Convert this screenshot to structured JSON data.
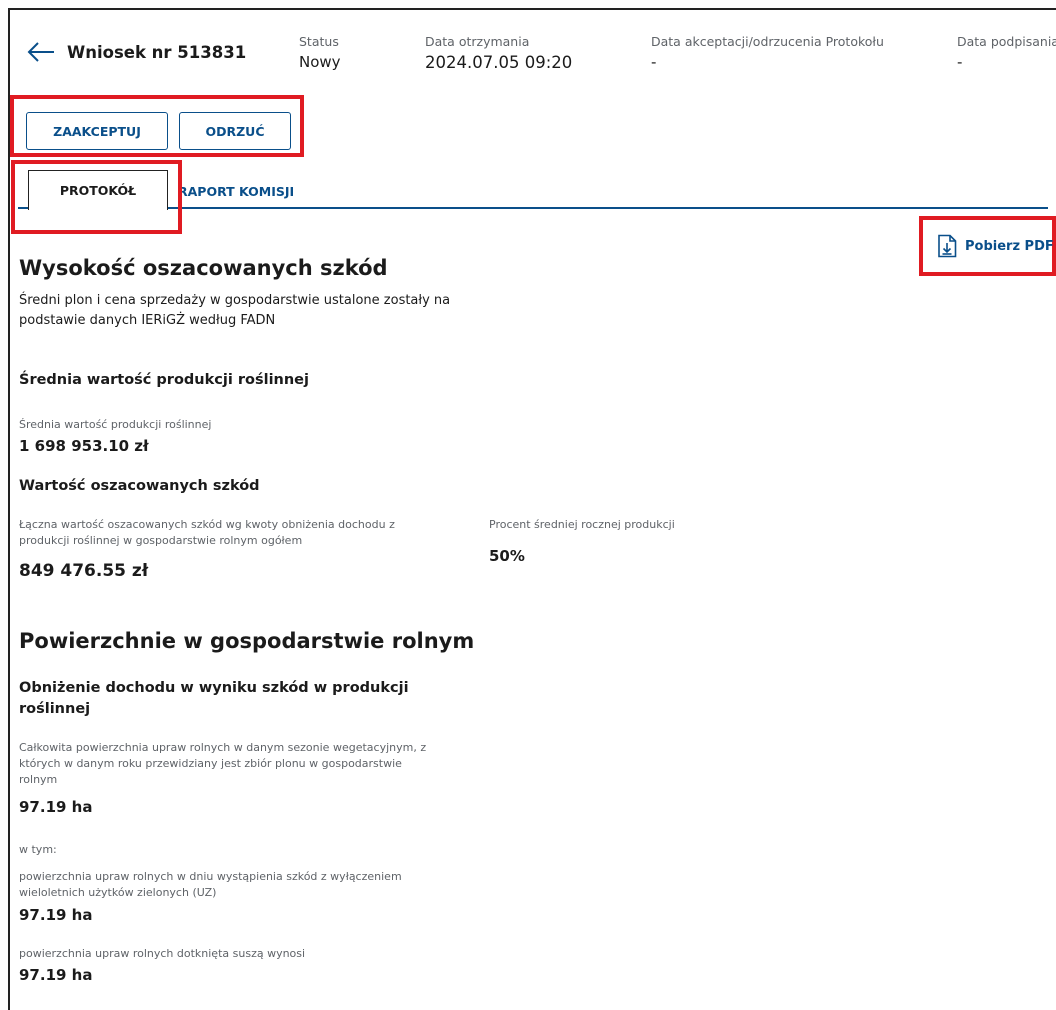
{
  "header": {
    "title": "Wniosek nr 513831",
    "status": {
      "label": "Status",
      "value": "Nowy"
    },
    "received": {
      "label": "Data otrzymania",
      "value": "2024.07.05 09:20"
    },
    "decision_date": {
      "label": "Data akceptacji/odrzucenia Protokołu",
      "value": "-"
    },
    "signed_date": {
      "label": "Data podpisania",
      "value": "-"
    }
  },
  "actions": {
    "accept_label": "ZAAKCEPTUJ",
    "reject_label": "ODRZUĆ"
  },
  "tabs": [
    {
      "label": "PROTOKÓŁ",
      "active": true
    },
    {
      "label": "RAPORT KOMISJI",
      "active": false
    }
  ],
  "download": {
    "label": "Pobierz PDF",
    "icon": "file-download-icon"
  },
  "damage": {
    "title": "Wysokość oszacowanych szkód",
    "description": "Średni plon i cena sprzedaży w gospodarstwie ustalone zostały na podstawie danych IERiGŻ według FADN",
    "avg_section_title": "Średnia wartość produkcji roślinnej",
    "avg_label": "Średnia wartość produkcji roślinnej",
    "avg_value": "1 698 953.10 zł",
    "estimated_section_title": "Wartość oszacowanych szkód",
    "total_label": "Łączna wartość oszacowanych szkód wg kwoty obniżenia dochodu z produkcji roślinnej w gospodarstwie rolnym ogółem",
    "total_value": "849 476.55 zł",
    "percent_label": "Procent średniej rocznej produkcji",
    "percent_value": "50%"
  },
  "areas": {
    "title": "Powierzchnie w gospodarstwie rolnym",
    "subtitle": "Obniżenie dochodu w wyniku szkód w produkcji roślinnej",
    "total_label": "Całkowita powierzchnia upraw rolnych w danym sezonie wegetacyjnym, z których w danym roku przewidziany jest zbiór plonu w gospodarstwie rolnym",
    "total_value": "97.19 ha",
    "including_label": "w tym:",
    "excl_label": "powierzchnia upraw rolnych w dniu wystąpienia szkód z wyłączeniem wieloletnich użytków zielonych (UZ)",
    "excl_value": "97.19 ha",
    "drought_label": "powierzchnia upraw rolnych dotknięta suszą wynosi",
    "drought_value": "97.19 ha"
  },
  "colors": {
    "accent": "#0a4f8a",
    "highlight": "#e01b22",
    "muted_text": "#5f6368"
  }
}
